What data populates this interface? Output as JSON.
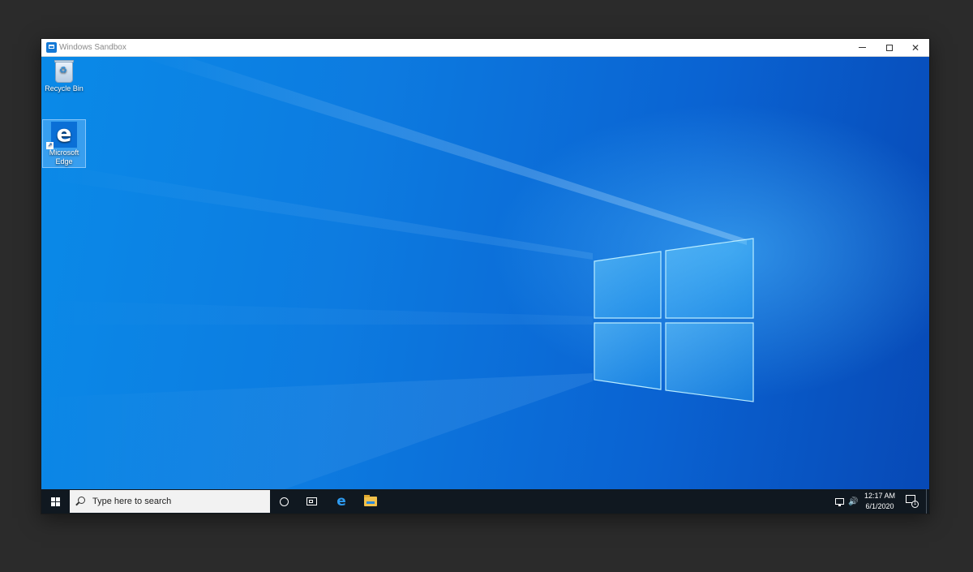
{
  "window": {
    "title": "Windows Sandbox",
    "controls": {
      "minimize": "minimize",
      "maximize": "maximize",
      "close": "✕"
    }
  },
  "desktop": {
    "icons": [
      {
        "label": "Recycle Bin",
        "icon": "recycle-bin-icon"
      },
      {
        "label": "Microsoft Edge",
        "icon": "edge-icon",
        "selected": true
      }
    ]
  },
  "taskbar": {
    "search_placeholder": "Type here to search",
    "pinned": [
      {
        "name": "cortana",
        "icon": "cortana-circle-icon"
      },
      {
        "name": "task-view",
        "icon": "task-view-icon"
      },
      {
        "name": "microsoft-edge",
        "icon": "edge-icon",
        "glyph": "e"
      },
      {
        "name": "file-explorer",
        "icon": "folder-icon"
      }
    ],
    "tray": {
      "network_icon": "network-icon",
      "volume_icon": "volume-icon",
      "volume_glyph": "🔊",
      "time": "12:17 AM",
      "date": "6/1/2020",
      "notification_count": "1"
    }
  },
  "colors": {
    "wallpaper_main": "#0a7be0",
    "taskbar": "#101820",
    "edge_blue": "#0a6fd6"
  }
}
